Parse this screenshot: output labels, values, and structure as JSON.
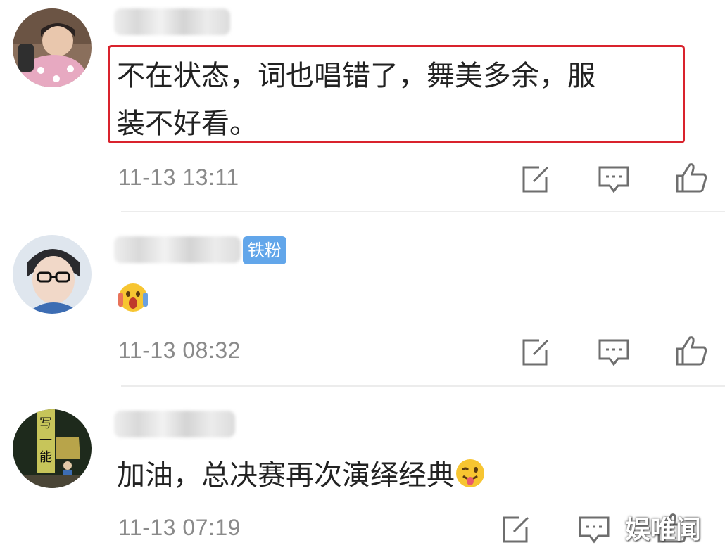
{
  "comments": [
    {
      "text_line1": "不在状态，词也唱错了，舞美多余，服",
      "text_line2": "装不好看。",
      "time": "11-13 13:11"
    },
    {
      "badge": "铁粉",
      "emoji": "scream-emoji",
      "time": "11-13 08:32"
    },
    {
      "text": "加油，总决赛再次演绎经典",
      "emoji": "tongue-wink-emoji",
      "time": "11-13 07:19"
    }
  ],
  "watermark": "娱唯闻",
  "colors": {
    "highlight": "#d9232d",
    "badge": "#62a6ea",
    "time": "#8a8a8a",
    "icon": "#6e6e6e"
  }
}
